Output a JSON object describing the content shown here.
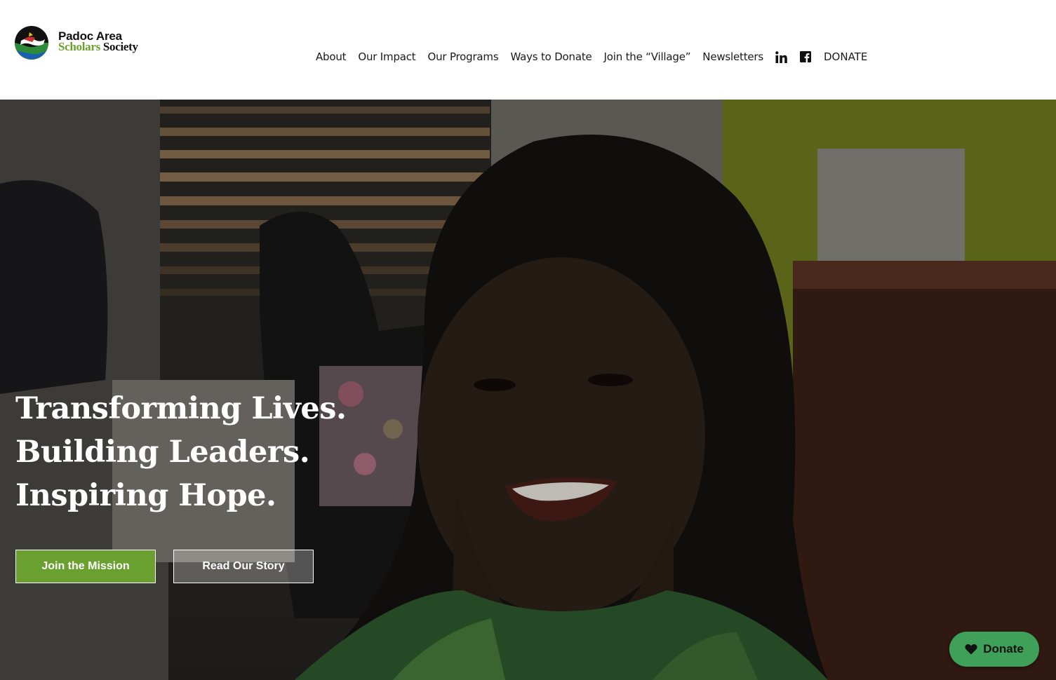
{
  "brand": {
    "name_line1": "Padoc Area",
    "name_line2_a": "Scholars",
    "name_line2_b": "Society"
  },
  "nav": {
    "items": [
      {
        "label": "About"
      },
      {
        "label": "Our Impact"
      },
      {
        "label": "Our Programs"
      },
      {
        "label": "Ways to Donate"
      },
      {
        "label": "Join the “Village”"
      },
      {
        "label": "Newsletters"
      }
    ],
    "social": [
      {
        "icon": "linkedin-icon"
      },
      {
        "icon": "facebook-icon"
      }
    ],
    "donate_label": "DONATE"
  },
  "hero": {
    "headline": [
      "Transforming Lives.",
      "Building Leaders.",
      "Inspiring Hope."
    ],
    "primary_button": "Join the Mission",
    "secondary_button": "Read Our Story"
  },
  "floating_donate": {
    "label": "Donate",
    "icon": "heart-icon"
  },
  "colors": {
    "brand_green": "#6aa02f",
    "donate_green": "#3fa05a",
    "text_dark": "#1a1a1a"
  }
}
